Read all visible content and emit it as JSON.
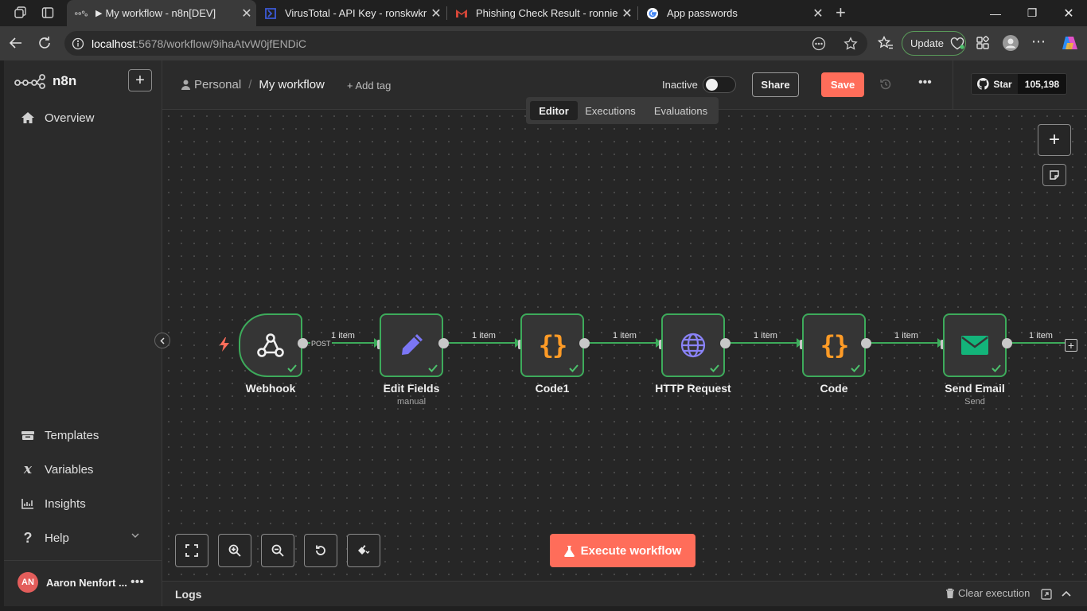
{
  "browser": {
    "tabs": [
      {
        "title": "My workflow - n8n[DEV]",
        "favicon": "n8n-icon",
        "active": true
      },
      {
        "title": "VirusTotal - API Key - ronskwkr",
        "favicon": "virustotal-icon",
        "active": false
      },
      {
        "title": "Phishing Check Result - ronniente",
        "favicon": "gmail-icon",
        "active": false
      },
      {
        "title": "App passwords",
        "favicon": "google-icon",
        "active": false
      }
    ],
    "url_host": "localhost",
    "url_path": ":5678/workflow/9ihaAtvW0jfENDiC",
    "update_label": "Update"
  },
  "sidebar": {
    "brand": "n8n",
    "overview": "Overview",
    "templates": "Templates",
    "variables": "Variables",
    "insights": "Insights",
    "help": "Help",
    "user_initials": "AN",
    "user_name": "Aaron Nenfort ..."
  },
  "header": {
    "project": "Personal",
    "separator": "/",
    "workflow_name": "My workflow",
    "add_tag": "+ Add tag",
    "status_label": "Inactive",
    "share_label": "Share",
    "save_label": "Save",
    "github_star": "Star",
    "github_count": "105,198",
    "tabs": [
      "Editor",
      "Executions",
      "Evaluations"
    ],
    "active_tab": "Editor"
  },
  "workflow": {
    "nodes": [
      {
        "name": "Webhook",
        "sub": "",
        "icon": "webhook-icon"
      },
      {
        "name": "Edit Fields",
        "sub": "manual",
        "icon": "pencil-icon"
      },
      {
        "name": "Code1",
        "sub": "",
        "icon": "code-braces-icon"
      },
      {
        "name": "HTTP Request",
        "sub": "",
        "icon": "globe-icon"
      },
      {
        "name": "Code",
        "sub": "",
        "icon": "code-braces-icon"
      },
      {
        "name": "Send Email",
        "sub": "Send",
        "icon": "envelope-icon"
      }
    ],
    "webhook_method": "POST",
    "connection_label": "1 item",
    "execute_label": "Execute workflow"
  },
  "logs": {
    "label": "Logs",
    "clear_label": "Clear execution"
  },
  "colors": {
    "accent": "#ff6d5a",
    "success": "#3dab5b",
    "code_orange": "#ff9b26",
    "pencil_purple": "#7b76f5",
    "email_green": "#13b47a"
  }
}
